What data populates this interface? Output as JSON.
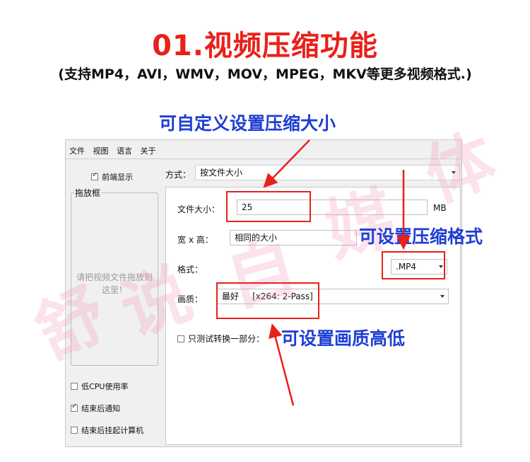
{
  "headline": "01.视频压缩功能",
  "subline": "(支持MP4，AVI，WMV，MOV，MPEG，MKV等更多视频格式.)",
  "watermark": [
    "舒",
    "说",
    "自",
    "媒",
    "体"
  ],
  "callouts": {
    "size": "可自定义设置压缩大小",
    "format": "可设置压缩格式",
    "quality": "可设置画质高低"
  },
  "menu": [
    "文件",
    "视图",
    "语言",
    "关于"
  ],
  "left_panel": {
    "front_display": "前端显示",
    "dropbox_title": "拖放框",
    "drop_hint": "请把视频文件拖放到这里！",
    "low_cpu": "低CPU使用率",
    "notify_done": "结束后通知",
    "shutdown_done": "结束后挂起计算机"
  },
  "mode": {
    "label": "方式：",
    "value": "按文件大小"
  },
  "form": {
    "size_label": "文件大小：",
    "size_value": "25",
    "size_unit": "MB",
    "dims_label": "宽 x 高：",
    "dims_value": "相同的大小",
    "format_label": "格式：",
    "format_value": ".MP4",
    "quality_label": "画质：",
    "quality_value": "最好     [x264: 2-Pass]",
    "test_part": "只测试转换一部分："
  },
  "colors": {
    "accent_red": "#e8211b",
    "callout_blue": "#1e3fd4"
  }
}
